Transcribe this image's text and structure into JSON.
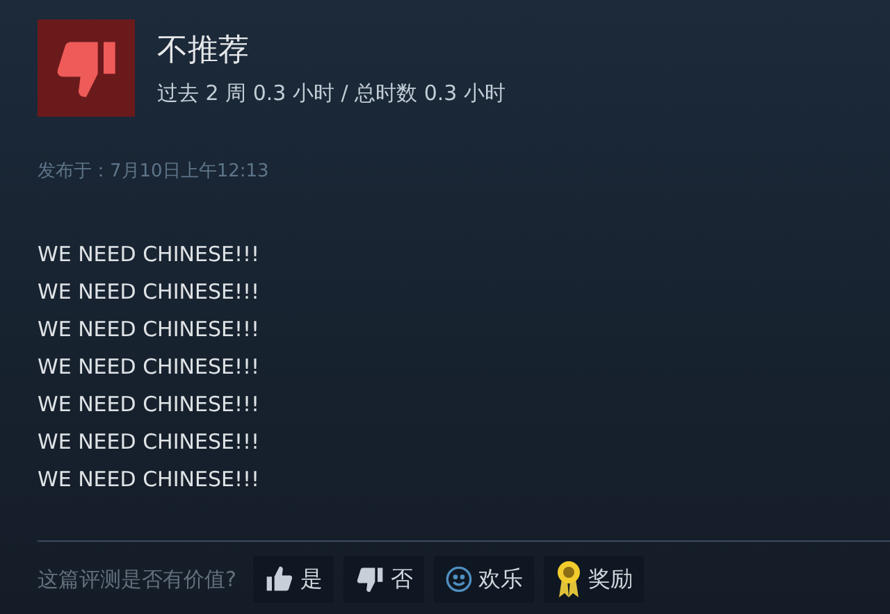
{
  "review": {
    "recommended": false,
    "verdict": "不推荐",
    "hours": "过去 2 周 0.3 小时 / 总时数 0.3 小时",
    "posted": "发布于：7月10日上午12:13",
    "lines": [
      "WE NEED CHINESE!!!",
      "WE NEED CHINESE!!!",
      "WE NEED CHINESE!!!",
      "WE NEED CHINESE!!!",
      "WE NEED CHINESE!!!",
      "WE NEED CHINESE!!!",
      "WE NEED CHINESE!!!"
    ]
  },
  "feedback": {
    "question": "这篇评测是否有价值?",
    "buttons": [
      {
        "kind": "yes",
        "label": "是"
      },
      {
        "kind": "no",
        "label": "否"
      },
      {
        "kind": "funny",
        "label": "欢乐"
      },
      {
        "kind": "award",
        "label": "奖励"
      }
    ]
  }
}
